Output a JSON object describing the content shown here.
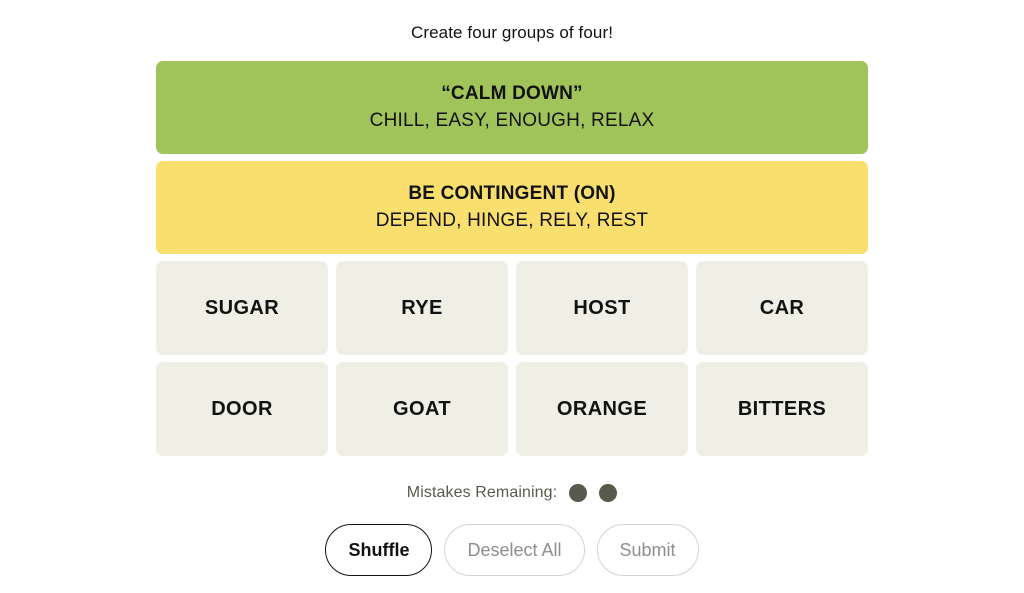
{
  "instruction": "Create four groups of four!",
  "colors": {
    "group_green": "#a0c35a",
    "group_yellow": "#f9df6d",
    "tile_bg": "#efefe6",
    "dot": "#5a594e",
    "text": "#121212",
    "disabled_text": "#8e8e8e",
    "disabled_border": "#d3d3d3",
    "page_bg": "#ffffff"
  },
  "solved_groups": [
    {
      "title": "“CALM DOWN”",
      "members": "CHILL, EASY, ENOUGH, RELAX",
      "color": "#a0c35a",
      "difficulty": "green"
    },
    {
      "title": "BE CONTINGENT (ON)",
      "members": "DEPEND, HINGE, RELY, REST",
      "color": "#f9df6d",
      "difficulty": "yellow"
    }
  ],
  "tile_rows": [
    [
      "SUGAR",
      "RYE",
      "HOST",
      "CAR"
    ],
    [
      "DOOR",
      "GOAT",
      "ORANGE",
      "BITTERS"
    ]
  ],
  "mistakes": {
    "label": "Mistakes Remaining:",
    "remaining": 2
  },
  "buttons": [
    {
      "label": "Shuffle",
      "state": "enabled"
    },
    {
      "label": "Deselect All",
      "state": "disabled"
    },
    {
      "label": "Submit",
      "state": "disabled"
    }
  ]
}
